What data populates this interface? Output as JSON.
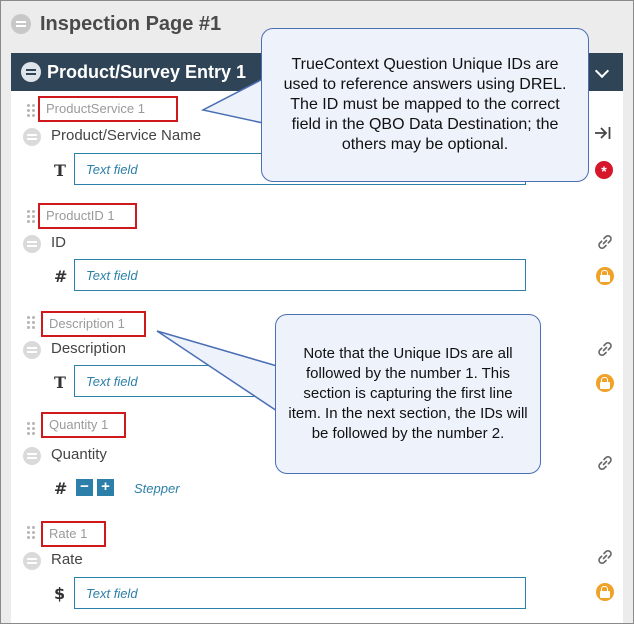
{
  "page": {
    "title": "Inspection Page #1"
  },
  "section": {
    "title": "Product/Survey Entry 1"
  },
  "questions": [
    {
      "unique_id": "ProductService 1",
      "label": "Product/Service Name",
      "type_glyph": "T",
      "placeholder": "Text field",
      "status_icon": "required-icon"
    },
    {
      "unique_id": "ProductID 1",
      "label": "ID",
      "type_glyph": "#",
      "placeholder": "Text field",
      "status_icon": "lock-icon"
    },
    {
      "unique_id": "Description 1",
      "label": "Description",
      "type_glyph": "T",
      "placeholder": "Text field",
      "status_icon": "lock-icon"
    },
    {
      "unique_id": "Quantity 1",
      "label": "Quantity",
      "type_glyph": "#",
      "stepper_label": "Stepper",
      "minus": "−",
      "plus": "+"
    },
    {
      "unique_id": "Rate 1",
      "label": "Rate",
      "type_glyph": "$",
      "placeholder": "Text field",
      "status_icon": "lock-icon"
    }
  ],
  "callouts": {
    "top": "TrueContext Question Unique IDs are used to reference answers using DREL. The ID must be mapped to the correct field in the QBO Data Destination; the others may be optional.",
    "middle": "Note that the Unique IDs are all followed by the number 1. This section is capturing the first line item. In the next section, the IDs will be followed by the number 2."
  },
  "colors": {
    "section_bar": "#2f4457",
    "accent": "#2c7fa8",
    "uid_border": "#d0191c",
    "lock": "#f0a127",
    "required": "#d6162a",
    "callout_border": "#4a6fb5"
  }
}
